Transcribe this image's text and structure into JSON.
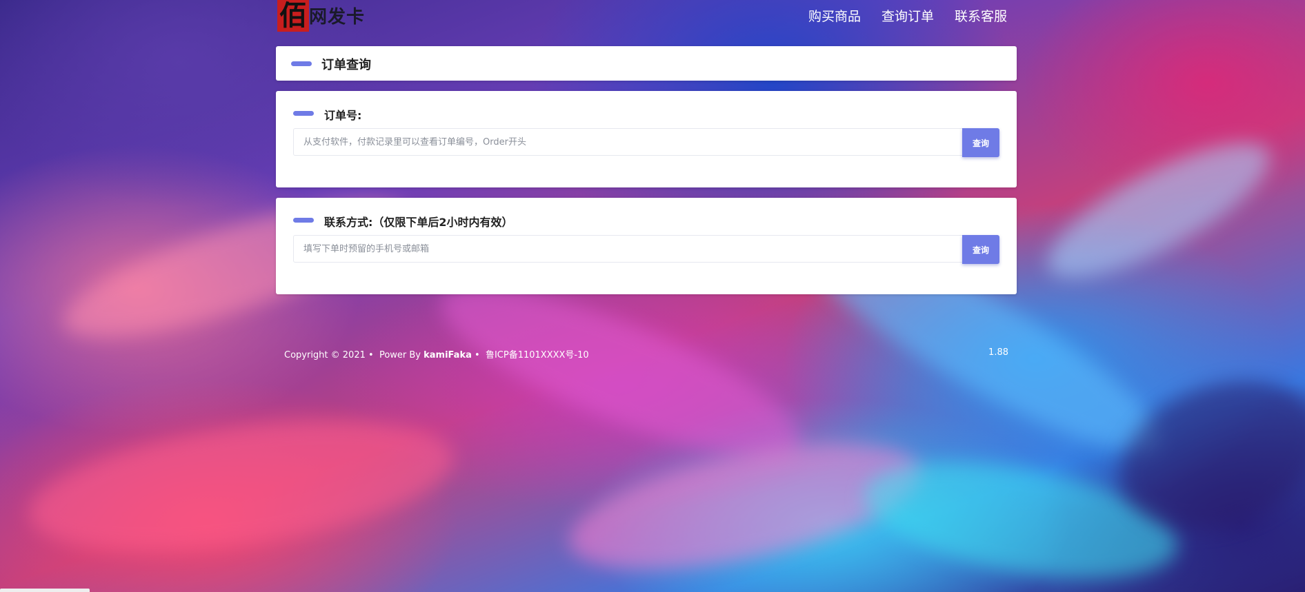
{
  "logo": {
    "badge_char": "佰",
    "text": "网发卡"
  },
  "nav": {
    "items": [
      "购买商品",
      "查询订单",
      "联系客服"
    ]
  },
  "title_card": {
    "title": "订单查询"
  },
  "order_card": {
    "label": "订单号:",
    "placeholder": "从支付软件，付款记录里可以查看订单编号，Order开头",
    "button": "查询"
  },
  "contact_card": {
    "label": "联系方式:（仅限下单后2小时内有效）",
    "placeholder": "填写下单时预留的手机号或邮箱",
    "button": "查询"
  },
  "footer": {
    "copyright": "Copyright © 2021 •",
    "power_by": "Power By",
    "brand": "kamiFaka",
    "separator": "•",
    "icp": "鲁ICP备1101XXXX号-10",
    "version": "1.88"
  },
  "colors": {
    "accent": "#6f7be6",
    "card_bg": "#ffffff",
    "logo_red": "#c81e1e"
  }
}
